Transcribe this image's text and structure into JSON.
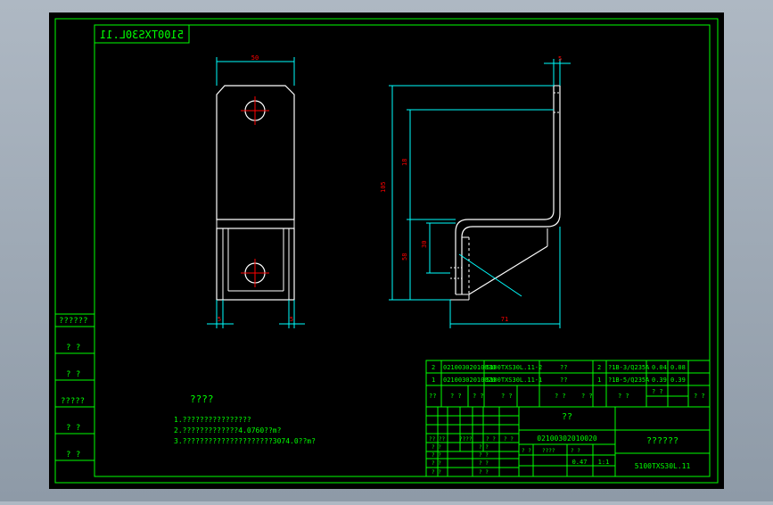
{
  "title_stamp": "5100TXS30L.11",
  "colors": {
    "background": "#000000",
    "frame": "#00ff00",
    "part": "#ffffff",
    "dimension": "#00ffff",
    "dimension_text": "#ff0000",
    "table_text": "#00ff00",
    "text": "#00ff00"
  },
  "dimensions": {
    "front_top_width": "50",
    "front_left_small": "5",
    "front_right_small": "5",
    "side_top_small": "5",
    "side_upper_height": "18",
    "side_total_height": "105",
    "side_lower_small": "30",
    "side_lower_height": "58",
    "side_bottom_width": "71"
  },
  "left_strip": [
    "??????",
    "? ?",
    "? ?",
    "?????",
    "? ?",
    "? ?"
  ],
  "notes": {
    "heading": "????",
    "lines": [
      "1.????????????????",
      "2.?????????????4.0760??m?",
      "3.?????????????????????3074.0??m?"
    ]
  },
  "parts_table": {
    "rows": [
      [
        "2",
        "02100302010030",
        "5100TXS30L.11-2",
        "??",
        "2",
        "?1B-3/Q235A",
        "0.04",
        "0.08"
      ],
      [
        "1",
        "02100302010020",
        "5100TXS30L.11-1",
        "??",
        "1",
        "?1B-5/Q235A",
        "0.39",
        "0.39"
      ]
    ],
    "header": [
      "??",
      "? ?",
      "? ?",
      "? ?",
      "? ?",
      "? ?",
      "? ?",
      "? ?",
      "? ?"
    ]
  },
  "title_block": {
    "material": "??",
    "code": "02100302010020",
    "company": "??????",
    "drawing_no": "5100TXS30L.11",
    "weight": "0.47",
    "scale": "1:1",
    "labels": [
      "?? ??",
      "????",
      "? ?",
      "? ?",
      "? ?",
      "? ?",
      "? ?",
      "? ?",
      "? ?",
      "? ?",
      "? ?",
      "? ?",
      "? ?",
      "? ?",
      "????"
    ]
  }
}
